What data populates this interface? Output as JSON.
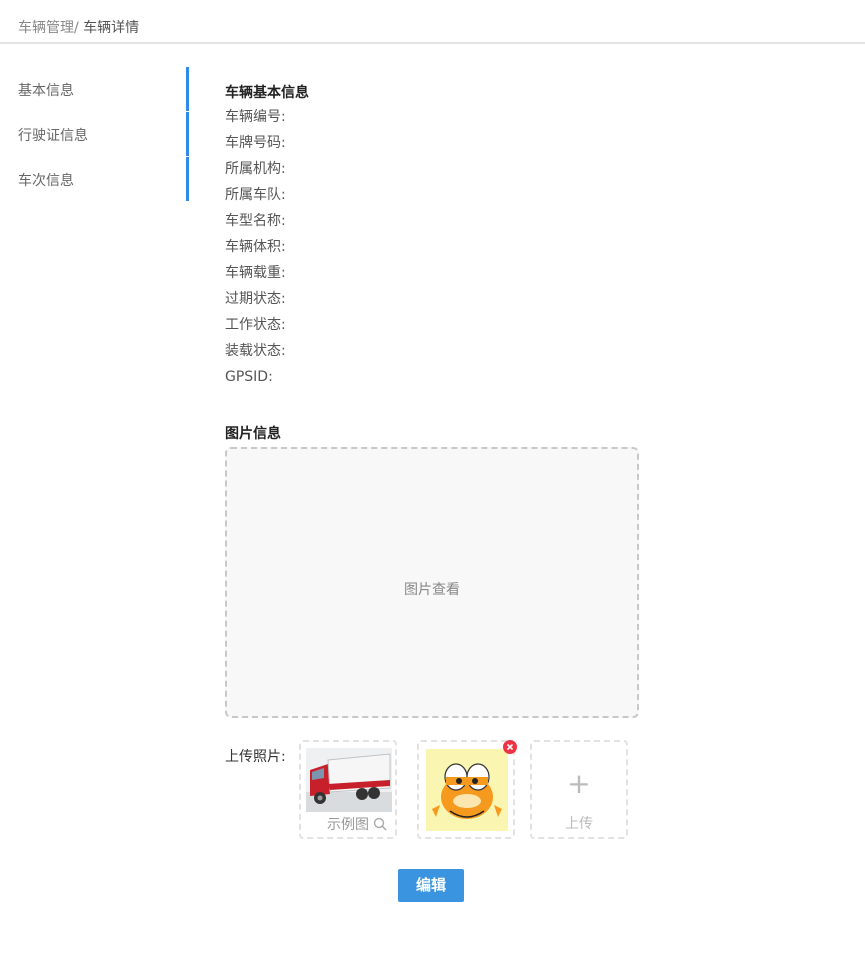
{
  "breadcrumb": {
    "parent": "车辆管理/",
    "current": "车辆详情"
  },
  "sidebar": {
    "items": [
      {
        "label": "基本信息"
      },
      {
        "label": "行驶证信息"
      },
      {
        "label": "车次信息"
      }
    ],
    "accent_color": "#2e8ce8"
  },
  "basic_info": {
    "title": "车辆基本信息",
    "fields": [
      {
        "label": "车辆编号:"
      },
      {
        "label": "车牌号码:"
      },
      {
        "label": "所属机构:"
      },
      {
        "label": "所属车队:"
      },
      {
        "label": "车型名称:"
      },
      {
        "label": "车辆体积:"
      },
      {
        "label": "车辆载重:"
      },
      {
        "label": "过期状态:"
      },
      {
        "label": "工作状态:"
      },
      {
        "label": "装载状态:"
      },
      {
        "label": "GPSID:"
      }
    ]
  },
  "image_info": {
    "title": "图片信息",
    "viewer_text": "图片查看",
    "upload_label": "上传照片:",
    "sample_caption": "示例图",
    "upload_button_text": "上传",
    "upload_plus": "+"
  },
  "actions": {
    "edit_label": "编辑"
  }
}
